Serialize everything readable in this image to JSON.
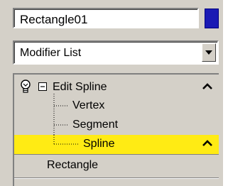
{
  "object_name": "Rectangle01",
  "object_color": "#1a1ab4",
  "modifier_list": {
    "selected": "Modifier List"
  },
  "stack": {
    "edit_spline": "Edit Spline",
    "sub_objects": [
      "Vertex",
      "Segment",
      "Spline"
    ],
    "base_object": "Rectangle",
    "highlight_color": "#ffeb14"
  },
  "icons": {
    "lightbulb": "lightbulb-icon",
    "collapse": "minus-box-icon",
    "chevron": "chevron-up-icon",
    "dropdown": "down-arrow-icon"
  }
}
